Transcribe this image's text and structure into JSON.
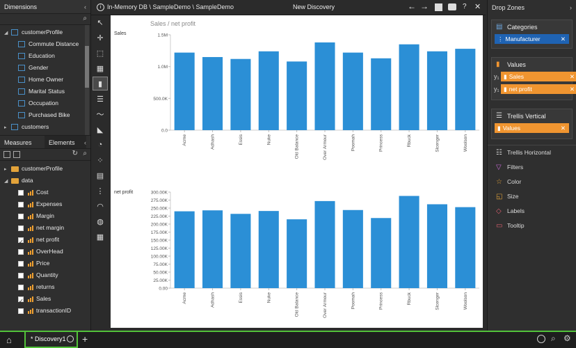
{
  "left_panel": {
    "dimensions_title": "Dimensions",
    "dimension_items": [
      "customerProfile",
      "Commute Distance",
      "Education",
      "Gender",
      "Home Owner",
      "Marital Status",
      "Occupation",
      "Purchased Bike",
      "customers"
    ],
    "measures_tab": "Measures",
    "elements_tab": "Elements",
    "measure_tree": {
      "folder1": "customerProfile",
      "folder2": "data",
      "items": [
        {
          "label": "Cost",
          "checked": false
        },
        {
          "label": "Expenses",
          "checked": false
        },
        {
          "label": "Margin",
          "checked": false
        },
        {
          "label": "net margin",
          "checked": false
        },
        {
          "label": "net profit",
          "checked": true
        },
        {
          "label": "OverHead",
          "checked": false
        },
        {
          "label": "Price",
          "checked": false
        },
        {
          "label": "Quantity",
          "checked": false
        },
        {
          "label": "returns",
          "checked": false
        },
        {
          "label": "Sales",
          "checked": true
        },
        {
          "label": "transactionID",
          "checked": false
        }
      ]
    }
  },
  "topbar": {
    "path": "In-Memory DB \\ SampleDemo \\ SampleDemo",
    "title": "New Discovery"
  },
  "canvas": {
    "title": "Sales / net profit"
  },
  "right_panel": {
    "title": "Drop Zones",
    "categories_label": "Categories",
    "categories_chip": "Manufacturer",
    "values_label": "Values",
    "values_chips": [
      "Sales",
      "net profit"
    ],
    "values_prefix": "y₁",
    "trellis_vertical_label": "Trellis Vertical",
    "trellis_vertical_chip": "Values",
    "trellis_horizontal_label": "Trellis Horizontal",
    "filters_label": "Filters",
    "color_label": "Color",
    "size_label": "Size",
    "labels_label": "Labels",
    "tooltip_label": "Tooltip"
  },
  "bottom_bar": {
    "tab_label": "* Discovery1"
  },
  "colors": {
    "bar": "#2b8fd6",
    "accent_green": "#52c23a",
    "chip_orange": "#f09530",
    "chip_blue": "#1f63b3"
  },
  "chart_data": [
    {
      "type": "bar",
      "title": "Sales",
      "categories": [
        "Acme",
        "Adhash",
        "Essis",
        "Nuke",
        "Old Balance",
        "Over Armour",
        "Poomah",
        "Princess",
        "Rbuck",
        "Slcenger",
        "Woolson"
      ],
      "values": [
        1220000,
        1150000,
        1120000,
        1240000,
        1080000,
        1380000,
        1220000,
        1130000,
        1350000,
        1240000,
        1280000
      ],
      "ylim": [
        0,
        1500000
      ],
      "yticks": [
        0,
        500000,
        1000000,
        1500000
      ],
      "yticklabels": [
        "0.0",
        "500.0K",
        "1.0M",
        "1.5M"
      ]
    },
    {
      "type": "bar",
      "title": "net profit",
      "categories": [
        "Acme",
        "Adhash",
        "Essis",
        "Nuke",
        "Old Balance",
        "Over Armour",
        "Poomah",
        "Princess",
        "Rbuck",
        "Slcenger",
        "Woolson"
      ],
      "values": [
        240000,
        243000,
        232000,
        241000,
        215000,
        272000,
        244000,
        219000,
        288000,
        262000,
        253000
      ],
      "ylim": [
        0,
        300000
      ],
      "yticks": [
        0,
        25000,
        50000,
        75000,
        100000,
        125000,
        150000,
        175000,
        200000,
        225000,
        250000,
        275000,
        300000
      ],
      "yticklabels": [
        "0.00",
        "25.00K",
        "50.00K",
        "75.00K",
        "100.00K",
        "125.00K",
        "150.00K",
        "175.00K",
        "200.00K",
        "225.00K",
        "250.00K",
        "275.00K",
        "300.00K"
      ]
    }
  ]
}
